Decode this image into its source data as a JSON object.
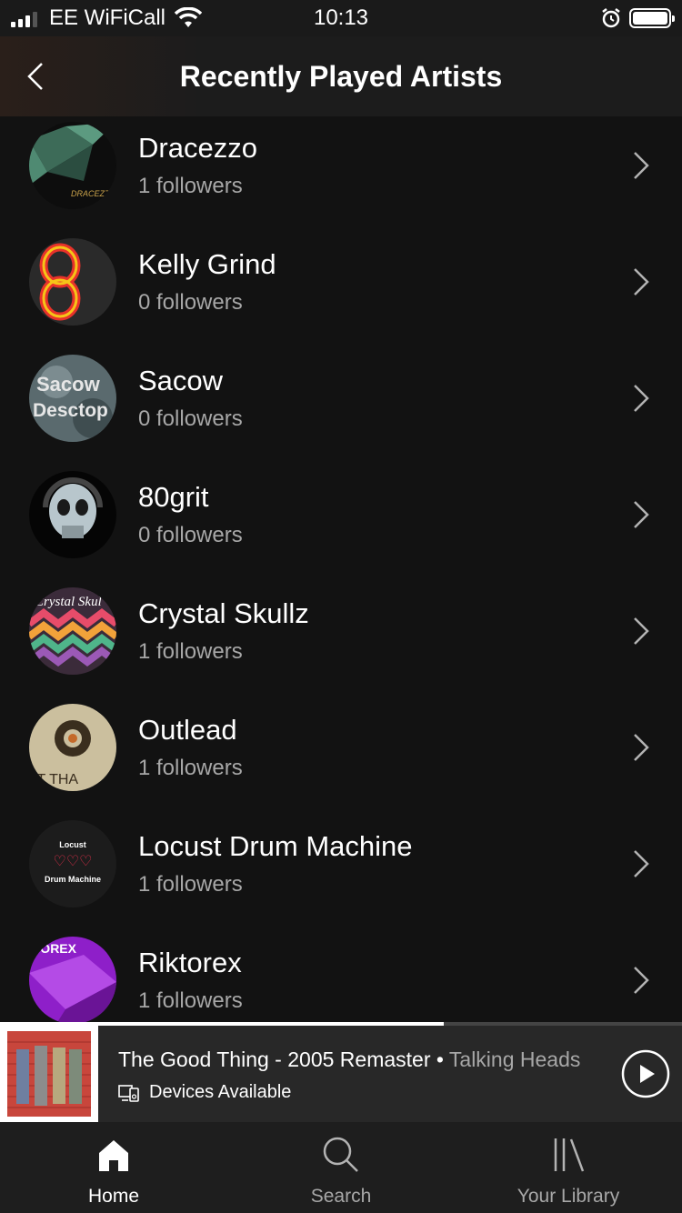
{
  "status_bar": {
    "carrier": "EE WiFiCall",
    "time": "10:13"
  },
  "header": {
    "title": "Recently Played Artists"
  },
  "artists": [
    {
      "name": "Dracezzo",
      "followers": "1 followers"
    },
    {
      "name": "Kelly Grind",
      "followers": "0 followers"
    },
    {
      "name": "Sacow",
      "followers": "0 followers"
    },
    {
      "name": "80grit",
      "followers": "0 followers"
    },
    {
      "name": "Crystal Skullz",
      "followers": "1 followers"
    },
    {
      "name": "Outlead",
      "followers": "1 followers"
    },
    {
      "name": "Locust Drum Machine",
      "followers": "1 followers"
    },
    {
      "name": "Riktorex",
      "followers": "1 followers"
    }
  ],
  "now_playing": {
    "title": "The Good Thing - 2005 Remaster",
    "separator": " • ",
    "artist": "Talking Heads",
    "devices_label": "Devices Available",
    "progress": 0.65
  },
  "tabs": [
    {
      "label": "Home",
      "icon": "home-icon",
      "active": true
    },
    {
      "label": "Search",
      "icon": "search-icon",
      "active": false
    },
    {
      "label": "Your Library",
      "icon": "library-icon",
      "active": false
    }
  ],
  "colors": {
    "background": "#121212",
    "header": "#1c1c1c",
    "player": "#282828",
    "tab_bar": "#1e1e1e",
    "secondary_text": "#a7a7a7"
  }
}
